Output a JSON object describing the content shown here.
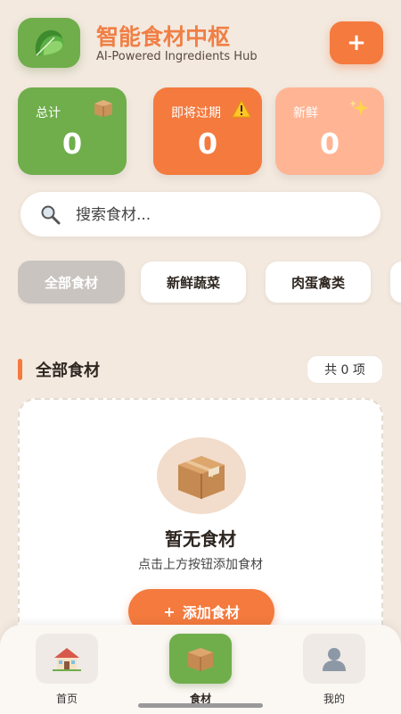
{
  "header": {
    "title": "智能食材中枢",
    "subtitle": "AI-Powered Ingredients Hub",
    "add_label": "+",
    "logo_icon": "leafy-greens-icon"
  },
  "stats": [
    {
      "label": "总计",
      "value": "0",
      "icon": "package-icon",
      "color": "#6FAE4B"
    },
    {
      "label": "即将过期",
      "value": "0",
      "icon": "warning-icon",
      "color": "#F47A3E"
    },
    {
      "label": "新鲜",
      "value": "0",
      "icon": "sparkle-icon",
      "color": "#FFB594"
    }
  ],
  "search": {
    "placeholder": "搜索食材...",
    "value": ""
  },
  "categories": [
    {
      "label": "全部食材",
      "active": true
    },
    {
      "label": "新鲜蔬菜",
      "active": false
    },
    {
      "label": "肉蛋禽类",
      "active": false
    }
  ],
  "section": {
    "title": "全部食材",
    "count": "共 0 项"
  },
  "empty": {
    "title": "暂无食材",
    "subtitle": "点击上方按钮添加食材",
    "button_icon": "+",
    "button_label": "添加食材"
  },
  "nav": [
    {
      "label": "首页",
      "icon": "house-icon",
      "active": false
    },
    {
      "label": "食材",
      "icon": "package-icon",
      "active": true
    },
    {
      "label": "我的",
      "icon": "user-icon",
      "active": false
    }
  ],
  "colors": {
    "accent": "#F47A3E",
    "green": "#6FAE4B",
    "background": "#F3E9DF"
  }
}
